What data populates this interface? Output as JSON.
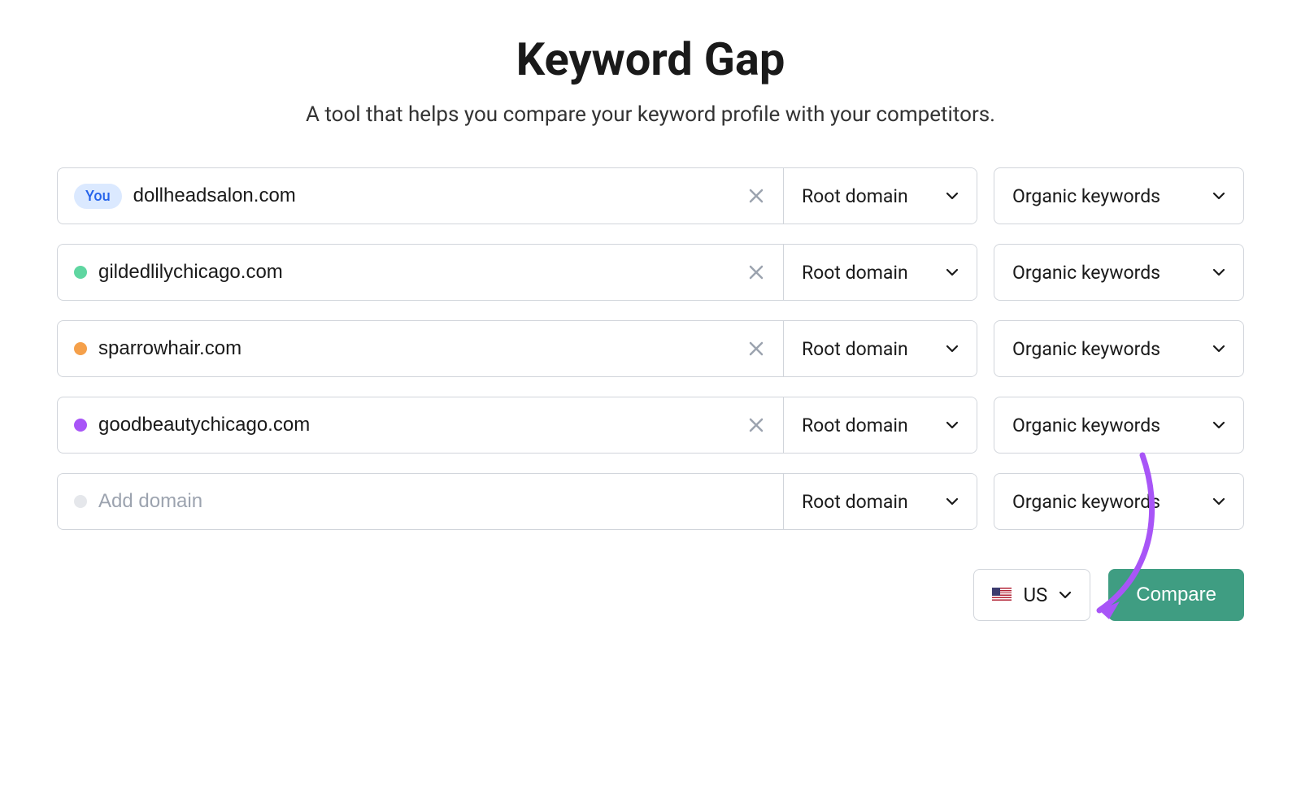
{
  "title": "Keyword Gap",
  "subtitle": "A tool that helps you compare your keyword profile with your competitors.",
  "you_label": "You",
  "add_domain_placeholder": "Add domain",
  "root_domain_label": "Root domain",
  "keyword_type_label": "Organic keywords",
  "country": {
    "code": "US",
    "label": "US"
  },
  "compare_label": "Compare",
  "rows": [
    {
      "domain": "dollheadsalon.com",
      "is_you": true,
      "dot_color": null
    },
    {
      "domain": "gildedlilychicago.com",
      "is_you": false,
      "dot_color": "#5fd6a1"
    },
    {
      "domain": "sparrowhair.com",
      "is_you": false,
      "dot_color": "#f5a04a"
    },
    {
      "domain": "goodbeautychicago.com",
      "is_you": false,
      "dot_color": "#a855f7"
    },
    {
      "domain": "",
      "is_you": false,
      "dot_color": "#e5e7eb"
    }
  ],
  "colors": {
    "primary_button": "#3f9d82",
    "you_badge_bg": "#dbe9ff",
    "you_badge_text": "#2563eb",
    "annotation_arrow": "#a855f7"
  }
}
